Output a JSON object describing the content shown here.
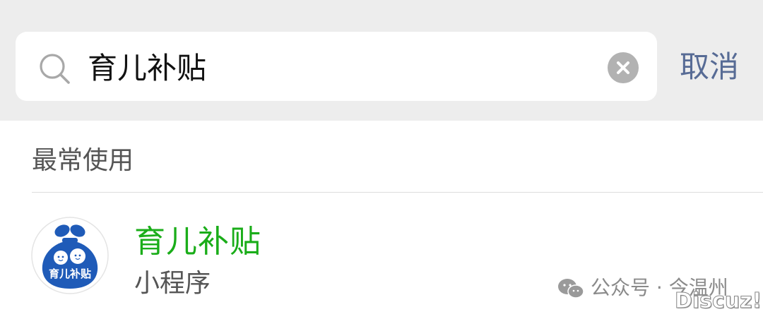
{
  "search": {
    "value": "育儿补贴",
    "cancel_label": "取消"
  },
  "section": {
    "title": "最常使用"
  },
  "results": [
    {
      "name": "育儿补贴",
      "type": "小程序",
      "icon_text": "育儿补贴"
    }
  ],
  "watermark": {
    "text": "公众号 · 今温州",
    "brand": "Discuz!"
  },
  "colors": {
    "accent_green": "#1aad19",
    "link_blue": "#576b95",
    "icon_blue": "#1f5bb8"
  },
  "icons": {
    "search": "search-icon",
    "clear": "clear-icon",
    "app": "app-icon",
    "wechat": "wechat-icon"
  }
}
